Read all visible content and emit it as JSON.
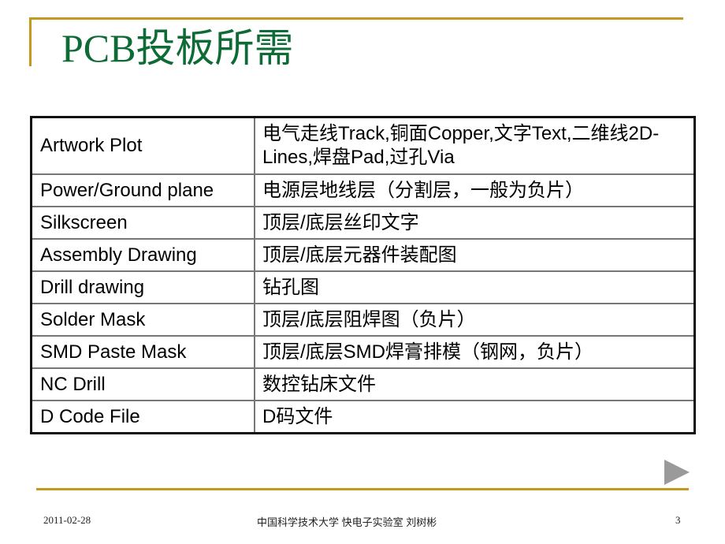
{
  "slide": {
    "title": "PCB投板所需",
    "colors": {
      "accent_gold": "#C49A1E",
      "title_green": "#0E6B36",
      "nav_gray": "#9A9A9A"
    }
  },
  "table": {
    "rows": [
      {
        "name": "Artwork Plot",
        "desc": "电气走线Track,铜面Copper,文字Text,二维线2D-Lines,焊盘Pad,过孔Via"
      },
      {
        "name": "Power/Ground plane",
        "desc": "电源层地线层（分割层，一般为负片）"
      },
      {
        "name": "Silkscreen",
        "desc": "顶层/底层丝印文字"
      },
      {
        "name": "Assembly Drawing",
        "desc": "顶层/底层元器件装配图"
      },
      {
        "name": "Drill drawing",
        "desc": "钻孔图"
      },
      {
        "name": "Solder Mask",
        "desc": "顶层/底层阻焊图（负片）"
      },
      {
        "name": "SMD Paste Mask",
        "desc": "顶层/底层SMD焊膏排模（钢网，负片）"
      },
      {
        "name": "NC Drill",
        "desc": "数控钻床文件"
      },
      {
        "name": "D Code File",
        "desc": "D码文件"
      }
    ]
  },
  "navigation": {
    "next_icon": "play-triangle-right"
  },
  "footer": {
    "date": "2011-02-28",
    "center": "中国科学技术大学 快电子实验室 刘树彬",
    "page_number": "3"
  }
}
